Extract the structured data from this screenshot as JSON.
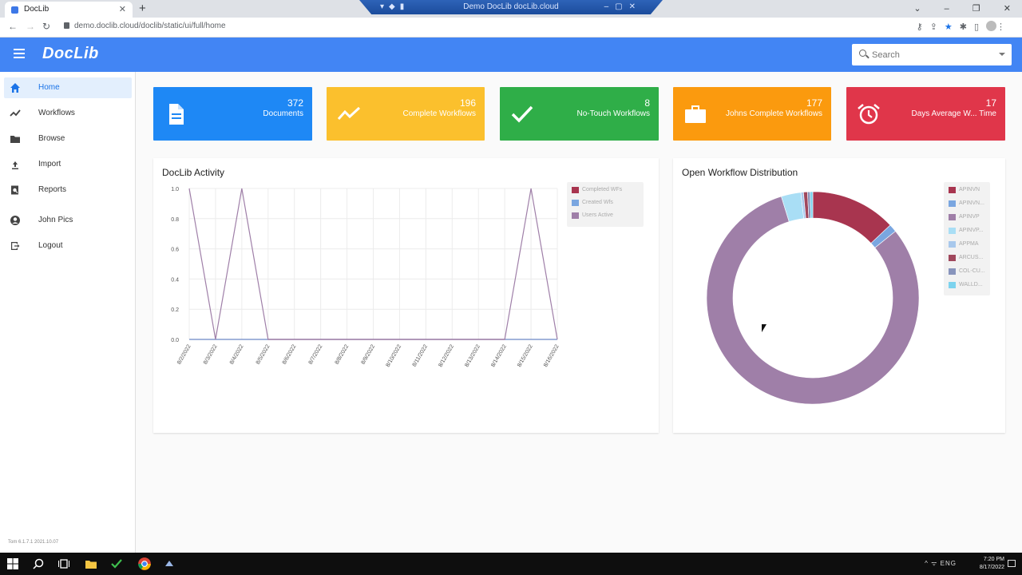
{
  "browser": {
    "tab_title": "DocLib",
    "tab_close": "✕",
    "new_tab": "+",
    "remote_title": "Demo DocLib docLib.cloud",
    "url": "demo.doclib.cloud/doclib/static/ui/full/home"
  },
  "header": {
    "logo": "DocLib",
    "search_placeholder": "Search"
  },
  "sidebar": {
    "items": [
      {
        "label": "Home",
        "icon": "home-icon",
        "active": true
      },
      {
        "label": "Workflows",
        "icon": "trend-icon"
      },
      {
        "label": "Browse",
        "icon": "folder-icon"
      },
      {
        "label": "Import",
        "icon": "upload-icon"
      },
      {
        "label": "Reports",
        "icon": "report-search-icon"
      },
      {
        "label": "John Pics",
        "icon": "account-icon"
      },
      {
        "label": "Logout",
        "icon": "logout-icon"
      }
    ],
    "version": "Tom 6.1.7.1 2021.10.07"
  },
  "cards": [
    {
      "value": "372",
      "label": "Documents",
      "color": "#1e88f5",
      "icon": "document-icon"
    },
    {
      "value": "196",
      "label": "Complete Workflows",
      "color": "#fbc02d",
      "icon": "trend-icon"
    },
    {
      "value": "8",
      "label": "No-Touch Workflows",
      "color": "#2fae48",
      "icon": "check-icon"
    },
    {
      "value": "177",
      "label": "Johns Complete Workflows",
      "color": "#fb9a0e",
      "icon": "briefcase-icon"
    },
    {
      "value": "17",
      "label": "Days Average W... Time",
      "color": "#e0364a",
      "icon": "alarm-icon"
    }
  ],
  "activity": {
    "title": "DocLib Activity"
  },
  "distribution": {
    "title": "Open Workflow Distribution"
  },
  "chart_data": [
    {
      "type": "line",
      "x": [
        "8/2/2022",
        "8/3/2022",
        "8/4/2022",
        "8/5/2022",
        "8/6/2022",
        "8/7/2022",
        "8/8/2022",
        "8/9/2022",
        "8/10/2022",
        "8/11/2022",
        "8/12/2022",
        "8/13/2022",
        "8/14/2022",
        "8/15/2022",
        "8/16/2022"
      ],
      "series": [
        {
          "name": "Completed WFs",
          "color": "#a8354f",
          "values": [
            0,
            0,
            0,
            0,
            0,
            0,
            0,
            0,
            0,
            0,
            0,
            0,
            0,
            0,
            0
          ]
        },
        {
          "name": "Created Wfs",
          "color": "#7aa6e0",
          "values": [
            0,
            0,
            0,
            0,
            0,
            0,
            0,
            0,
            0,
            0,
            0,
            0,
            0,
            0,
            0
          ]
        },
        {
          "name": "Users Active",
          "color": "#9f7fa8",
          "values": [
            1,
            0,
            1,
            0,
            0,
            0,
            0,
            0,
            0,
            0,
            0,
            0,
            0,
            1,
            0
          ]
        }
      ],
      "yticks": [
        "1.0",
        "0.8",
        "0.6",
        "0.4",
        "0.2",
        "0.0"
      ],
      "ylim": [
        0,
        1
      ],
      "grid": true,
      "legend": "top-right"
    },
    {
      "type": "pie",
      "categories": [
        "APINVN",
        "APINVN...",
        "APINVP",
        "APINVP...",
        "APPMA",
        "ARCUS...",
        "COL-CU...",
        "WALLD..."
      ],
      "colors": [
        "#a8354f",
        "#7aa6e0",
        "#9f7fa8",
        "#a9def5",
        "#a8c8ec",
        "#a0475c",
        "#8894bc",
        "#7dd3ee"
      ],
      "values": [
        0.13,
        0.012,
        0.81,
        0.03,
        0.004,
        0.006,
        0.004,
        0.004
      ],
      "legend": "right"
    }
  ],
  "taskbar": {
    "tray": "ENG",
    "time": "7:20 PM",
    "date": "8/17/2022"
  }
}
